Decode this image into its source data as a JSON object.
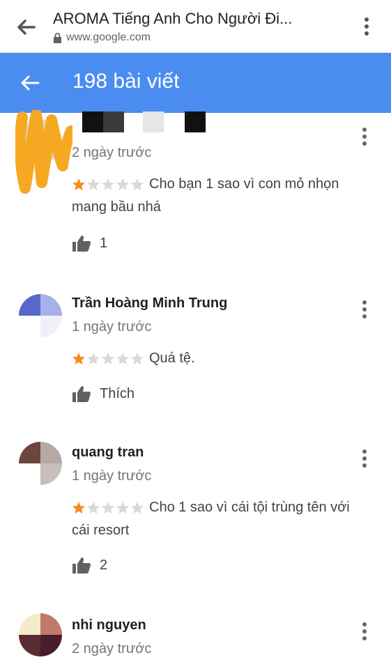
{
  "browser": {
    "title": "AROMA Tiếng Anh Cho Người Đi...",
    "url": "www.google.com",
    "back_icon": "arrow-left-icon",
    "menu_icon": "more-vert-icon"
  },
  "appbar": {
    "title": "198 bài viết",
    "back_icon": "arrow-left-icon",
    "background": "#4a8cf0"
  },
  "colors": {
    "star_filled": "#f38d1c",
    "star_empty": "#d9d9d9",
    "text_secondary": "#757575"
  },
  "reviews": [
    {
      "name": "",
      "time": "2 ngày trước",
      "rating": 1,
      "max_rating": 5,
      "text": "Cho bạn 1 sao vì con mỏ nhọn mang bầu nhá",
      "likes": "1"
    },
    {
      "name": "Trần Hoàng Minh Trung",
      "time": "1 ngày trước",
      "rating": 1,
      "max_rating": 5,
      "text": "Quá tệ.",
      "likes": "Thích"
    },
    {
      "name": "quang tran",
      "time": "1 ngày trước",
      "rating": 1,
      "max_rating": 5,
      "text": "Cho 1 sao vì cái tội trùng tên với cái resort",
      "likes": "2"
    },
    {
      "name": "nhi nguyen",
      "time": "2 ngày trước",
      "rating": null,
      "max_rating": 5,
      "text": "",
      "likes": ""
    }
  ]
}
